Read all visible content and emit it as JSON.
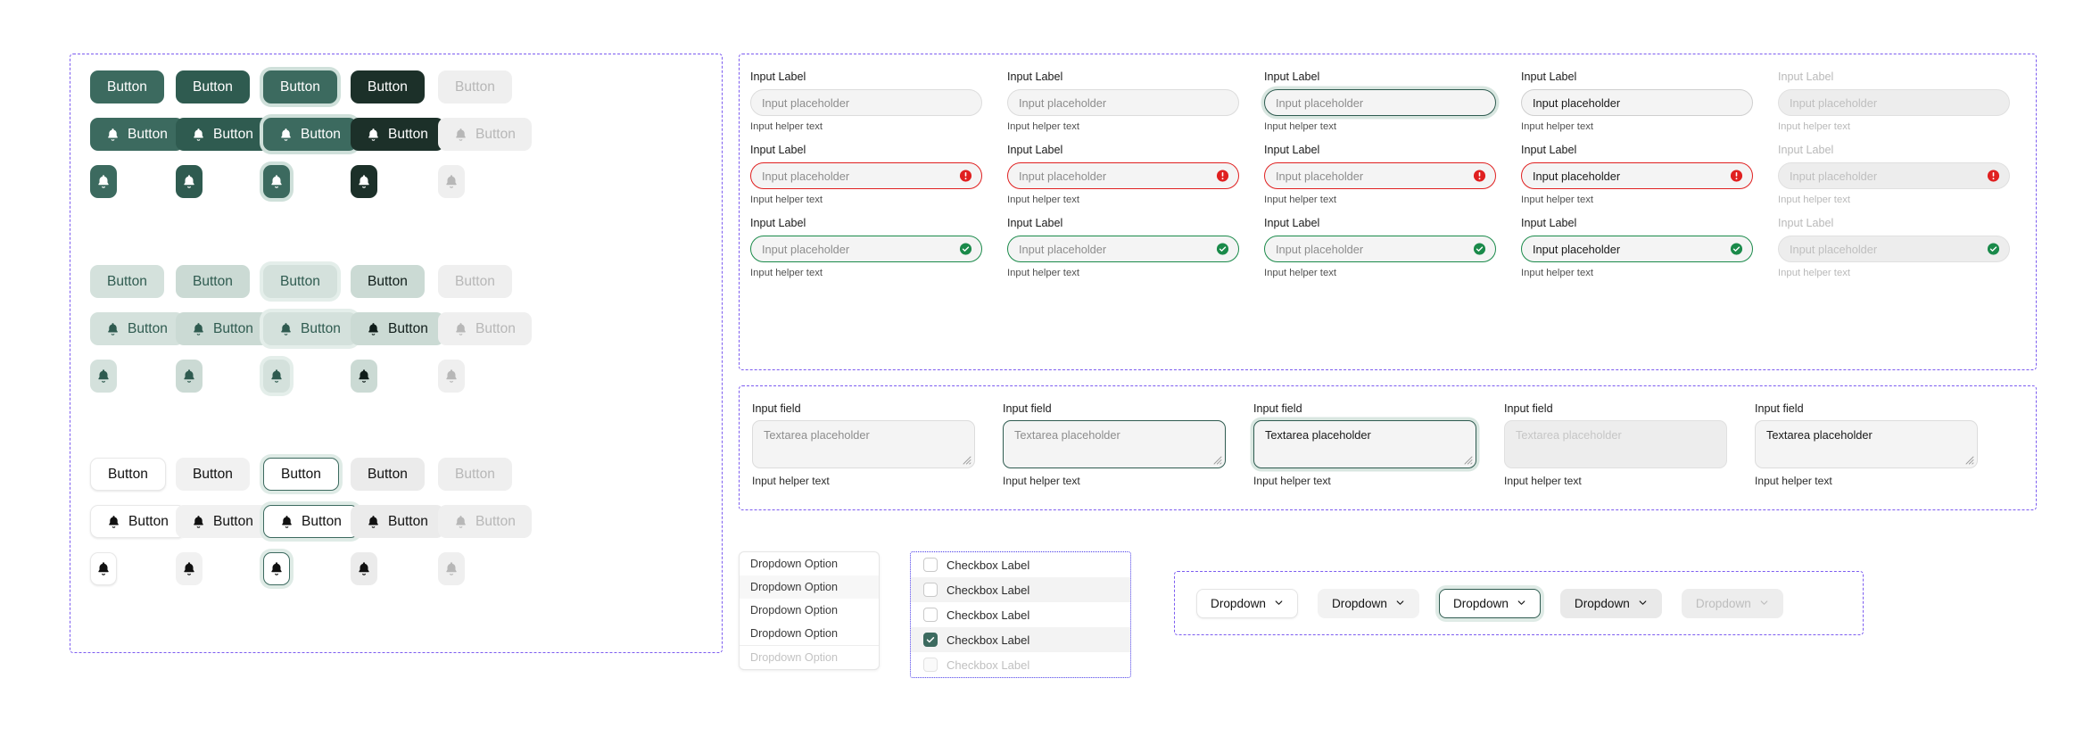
{
  "colors": {
    "primary": "#3c6a5f",
    "primary_pressed": "#1c3029",
    "secondary_bg": "#d4e1dc",
    "disabled_bg": "#efefef",
    "disabled_text": "#b7b7b7",
    "error": "#e02020",
    "success": "#1a8a4a",
    "annotation_border": "#7c5cf0"
  },
  "buttons": {
    "label": "Button",
    "states": [
      "default",
      "hover",
      "focus",
      "pressed",
      "disabled"
    ],
    "groups": [
      {
        "name": "primary",
        "rows": [
          {
            "kind": "text",
            "variants": [
              "v-primary-default",
              "v-primary-hover",
              "v-primary-focus",
              "v-primary-press",
              "v-primary-disabled"
            ]
          },
          {
            "kind": "icon-text",
            "variants": [
              "v-primary-default",
              "v-primary-hover",
              "v-primary-focus",
              "v-primary-press",
              "v-primary-disabled"
            ]
          },
          {
            "kind": "icon-only",
            "variants": [
              "v-primary-default",
              "v-primary-hover",
              "v-primary-focus",
              "v-primary-press",
              "v-primary-disabled"
            ]
          }
        ]
      },
      {
        "name": "secondary",
        "rows": [
          {
            "kind": "text",
            "variants": [
              "v-secondary-default",
              "v-secondary-hover",
              "v-secondary-focus",
              "v-secondary-press",
              "v-secondary-disabled"
            ]
          },
          {
            "kind": "icon-text",
            "variants": [
              "v-secondary-default",
              "v-secondary-hover",
              "v-secondary-focus",
              "v-secondary-press",
              "v-secondary-disabled"
            ]
          },
          {
            "kind": "icon-only",
            "variants": [
              "v-secondary-default",
              "v-secondary-hover",
              "v-secondary-focus",
              "v-secondary-press",
              "v-secondary-disabled"
            ]
          }
        ]
      },
      {
        "name": "tertiary",
        "rows": [
          {
            "kind": "text",
            "variants": [
              "v-ghost-default",
              "v-ghost-hover",
              "v-ghost-focus",
              "v-ghost-press",
              "v-ghost-disabled"
            ]
          },
          {
            "kind": "icon-text",
            "variants": [
              "v-ghost-default",
              "v-ghost-hover",
              "v-ghost-focus",
              "v-ghost-press",
              "v-ghost-disabled"
            ]
          },
          {
            "kind": "icon-only",
            "variants": [
              "v-ghost-default",
              "v-ghost-hover",
              "v-ghost-focus",
              "v-ghost-press",
              "v-ghost-disabled"
            ]
          }
        ]
      }
    ],
    "icon_name": "bell-icon"
  },
  "inputs": {
    "label": "Input Label",
    "placeholder": "Input placeholder",
    "helper": "Input helper text",
    "rows": [
      {
        "state": "default",
        "columns": [
          {
            "variant": "",
            "dim": false
          },
          {
            "variant": "",
            "dim": false
          },
          {
            "variant": "s-focus",
            "dim": false
          },
          {
            "variant": "s-filled",
            "dim": false
          },
          {
            "variant": "s-disabled",
            "dim": true
          }
        ]
      },
      {
        "state": "error",
        "columns": [
          {
            "variant": "s-error",
            "dim": false,
            "icon": "error-icon"
          },
          {
            "variant": "s-error",
            "dim": false,
            "icon": "error-icon"
          },
          {
            "variant": "s-error",
            "dim": false,
            "icon": "error-icon"
          },
          {
            "variant": "s-error s-filled",
            "dim": false,
            "icon": "error-icon"
          },
          {
            "variant": "s-error s-disabled",
            "dim": true,
            "icon": "error-icon"
          }
        ]
      },
      {
        "state": "success",
        "columns": [
          {
            "variant": "s-success",
            "dim": false,
            "icon": "success-icon"
          },
          {
            "variant": "s-success",
            "dim": false,
            "icon": "success-icon"
          },
          {
            "variant": "s-success",
            "dim": false,
            "icon": "success-icon"
          },
          {
            "variant": "s-success s-filled",
            "dim": false,
            "icon": "success-icon"
          },
          {
            "variant": "s-success s-disabled",
            "dim": true,
            "icon": "success-icon"
          }
        ]
      }
    ]
  },
  "textareas": {
    "label": "Input field",
    "placeholder": "Textarea placeholder",
    "helper": "Input helper text",
    "columns": [
      {
        "variant": ""
      },
      {
        "variant": "s-focus"
      },
      {
        "variant": "s-active"
      },
      {
        "variant": "s-disabled"
      },
      {
        "variant": "s-filled"
      }
    ]
  },
  "dropdown_list": {
    "options": [
      {
        "label": "Dropdown  Option",
        "state": "default"
      },
      {
        "label": "Dropdown  Option",
        "state": "hover"
      },
      {
        "label": "Dropdown  Option",
        "state": "default"
      },
      {
        "label": "Dropdown  Option",
        "state": "default"
      },
      {
        "label": "Dropdown  Option",
        "state": "disabled"
      }
    ]
  },
  "checkboxes": {
    "items": [
      {
        "label": "Checkbox Label",
        "checked": false,
        "state": "default"
      },
      {
        "label": "Checkbox Label",
        "checked": false,
        "state": "hover"
      },
      {
        "label": "Checkbox Label",
        "checked": false,
        "state": "default"
      },
      {
        "label": "Checkbox Label",
        "checked": true,
        "state": "hover"
      },
      {
        "label": "Checkbox Label",
        "checked": false,
        "state": "disabled"
      }
    ]
  },
  "dropdown_buttons": {
    "label": "Dropdown",
    "icon_name": "chevron-down-icon",
    "items": [
      {
        "state": "default"
      },
      {
        "state": "hover"
      },
      {
        "state": "focus"
      },
      {
        "state": "press"
      },
      {
        "state": "disabled"
      }
    ]
  }
}
